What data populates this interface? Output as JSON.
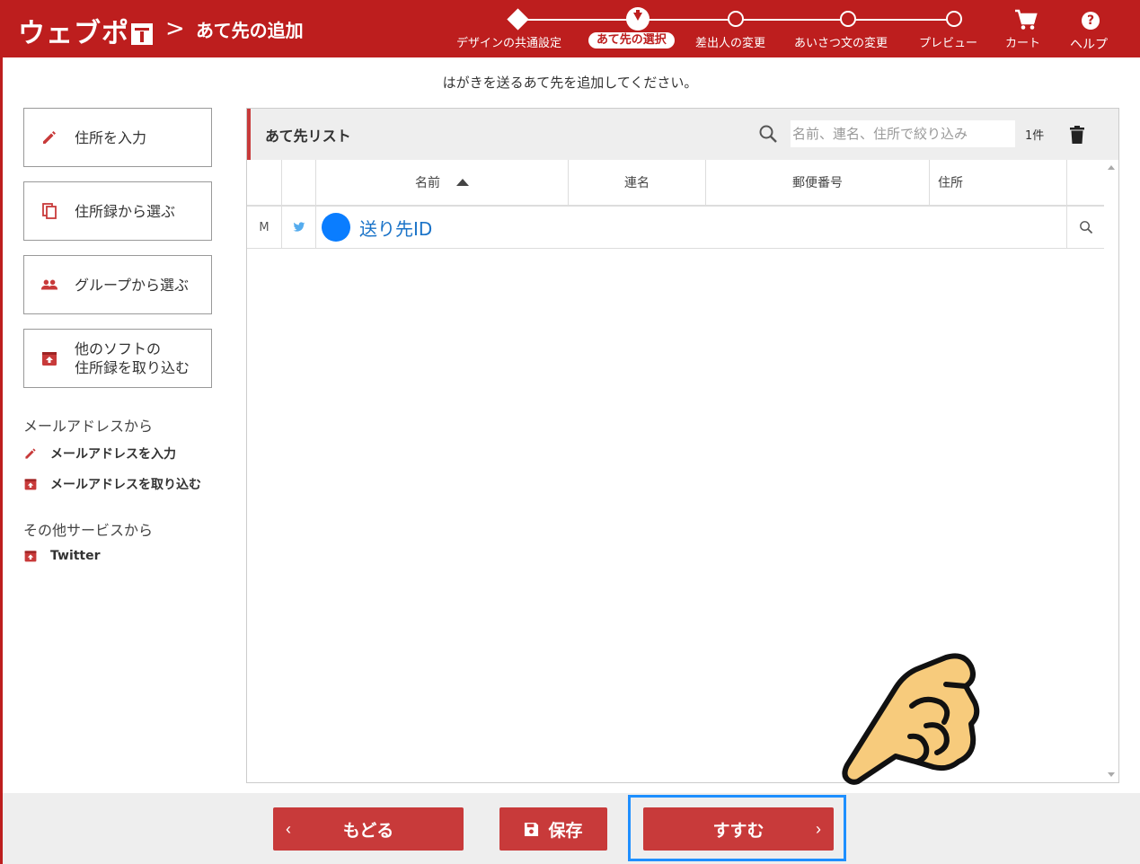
{
  "header": {
    "logo_text": "ウェブポ",
    "breadcrumb_sep": ">",
    "title": "あて先の追加",
    "steps": [
      {
        "label": "デザインの共通設定",
        "state": "done"
      },
      {
        "label": "あて先の選択",
        "state": "current"
      },
      {
        "label": "差出人の変更",
        "state": "todo"
      },
      {
        "label": "あいさつ文の変更",
        "state": "todo"
      },
      {
        "label": "プレビュー",
        "state": "todo"
      }
    ],
    "cart_label": "カート",
    "help_label": "ヘルプ",
    "help_glyph": "?"
  },
  "instruction": "はがきを送るあて先を追加してください。",
  "sidebar": {
    "buttons": [
      {
        "label": "住所を入力",
        "icon": "pencil-icon"
      },
      {
        "label": "住所録から選ぶ",
        "icon": "copy-icon"
      },
      {
        "label": "グループから選ぶ",
        "icon": "group-icon"
      },
      {
        "label": "他のソフトの\n住所録を取り込む",
        "icon": "import-icon"
      }
    ],
    "email_heading": "メールアドレスから",
    "email_links": [
      {
        "label": "メールアドレスを入力",
        "icon": "pencil-icon"
      },
      {
        "label": "メールアドレスを取り込む",
        "icon": "import-icon"
      }
    ],
    "other_heading": "その他サービスから",
    "other_links": [
      {
        "label": "Twitter",
        "icon": "import-icon"
      }
    ]
  },
  "list": {
    "title": "あて先リスト",
    "search_placeholder": "名前、連名、住所で絞り込み",
    "count": "1件",
    "columns": {
      "name": "名前",
      "joint": "連名",
      "postal": "郵便番号",
      "address": "住所"
    },
    "rows": [
      {
        "type": "M",
        "source_icon": "twitter-icon",
        "name": "送り先ID",
        "joint": "",
        "postal": "",
        "address": ""
      }
    ]
  },
  "footer": {
    "back_label": "もどる",
    "back_chevron": "‹",
    "save_label": "保存",
    "next_label": "すすむ",
    "next_chevron": "›"
  },
  "colors": {
    "brand_red": "#bd1e1e",
    "button_red": "#c83a3a",
    "highlight_blue": "#1e8fff",
    "avatar_blue": "#0a7dff"
  }
}
